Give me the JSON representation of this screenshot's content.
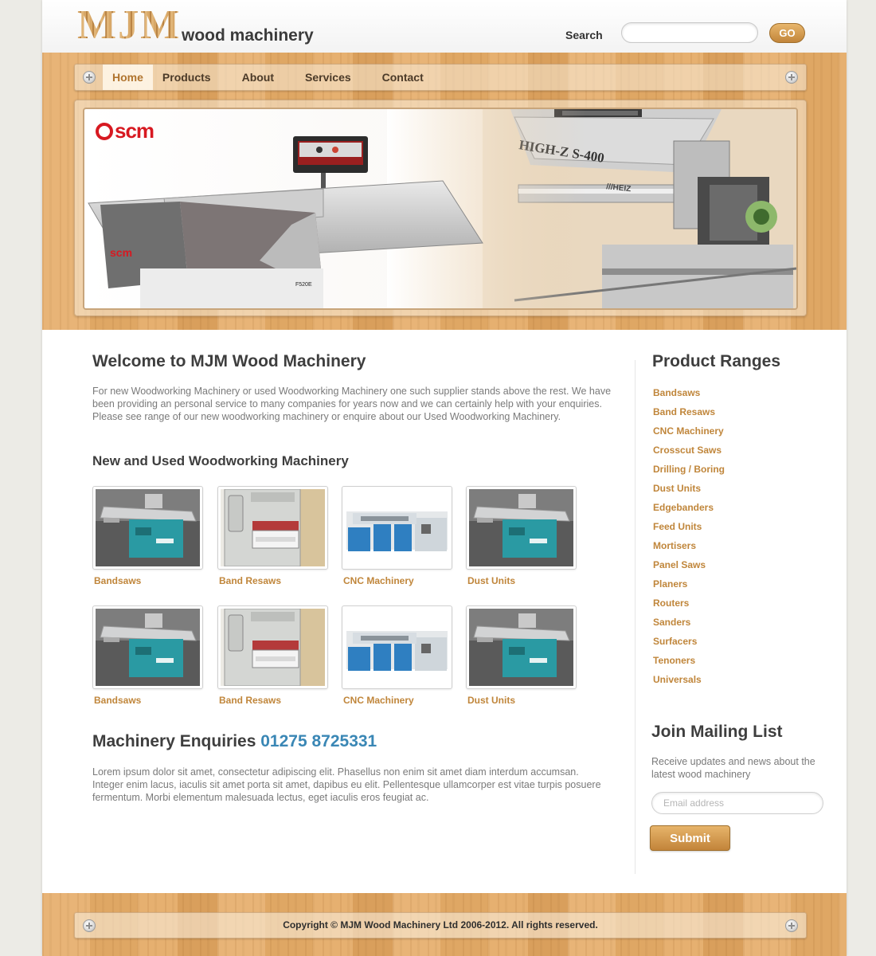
{
  "brand": {
    "logo_text": "MJM",
    "tagline": "wood machinery"
  },
  "search": {
    "label": "Search",
    "value": "",
    "placeholder": "",
    "button_label": "GO"
  },
  "nav": {
    "items": [
      {
        "label": "Home",
        "active": true
      },
      {
        "label": "Products",
        "active": false
      },
      {
        "label": "About",
        "active": false
      },
      {
        "label": "Services",
        "active": false
      },
      {
        "label": "Contact",
        "active": false
      }
    ]
  },
  "banner": {
    "brand_logo": "scm",
    "machine_left_badge": "scm",
    "machine_left_model": "F520E",
    "machine_right_label": "HIGH-Z S-400",
    "machine_right_maker": "///HEIZ"
  },
  "main": {
    "welcome_title": "Welcome to MJM Wood Machinery",
    "welcome_text": "For new Woodworking Machinery or used Woodworking Machinery one such supplier stands above the rest. We have been providing an personal service to many companies for years now and we can certainly help with your enquiries. Please see range of our new woodworking machinery or enquire about our Used Woodworking Machinery.",
    "section_title": "New and Used Woodworking Machinery",
    "products": [
      {
        "label": "Bandsaws",
        "image": "spindle-moulder"
      },
      {
        "label": "Band Resaws",
        "image": "wide-belt-sander"
      },
      {
        "label": "CNC Machinery",
        "image": "four-sided-planer"
      },
      {
        "label": "Dust Units",
        "image": "spindle-moulder"
      },
      {
        "label": "Bandsaws",
        "image": "spindle-moulder"
      },
      {
        "label": "Band Resaws",
        "image": "wide-belt-sander"
      },
      {
        "label": "CNC Machinery",
        "image": "four-sided-planer"
      },
      {
        "label": "Dust Units",
        "image": "spindle-moulder"
      }
    ],
    "enquiries_title": "Machinery Enquiries",
    "enquiries_phone": "01275 8725331",
    "enquiries_text": "Lorem ipsum dolor sit amet, consectetur adipiscing elit. Phasellus non enim sit amet diam interdum accumsan. Integer enim lacus, iaculis sit amet porta sit amet, dapibus eu elit. Pellentesque ullamcorper est vitae turpis posuere fermentum. Morbi elementum malesuada lectus, eget iaculis eros feugiat ac."
  },
  "sidebar": {
    "ranges_title": "Product Ranges",
    "ranges": [
      "Bandsaws",
      "Band Resaws",
      "CNC Machinery",
      "Crosscut Saws",
      "Drilling / Boring",
      "Dust Units",
      "Edgebanders",
      "Feed Units",
      "Mortisers",
      "Panel Saws",
      "Planers",
      "Routers",
      "Sanders",
      "Surfacers",
      "Tenoners",
      "Universals"
    ],
    "mailing_title": "Join Mailing List",
    "mailing_text": "Receive updates and news about the latest wood machinery",
    "email_placeholder": "Email address",
    "email_value": "",
    "submit_label": "Submit"
  },
  "footer": {
    "copyright": "Copyright © MJM Wood Machinery Ltd 2006-2012. All rights reserved."
  },
  "colors": {
    "accent": "#c0863b",
    "phone": "#3a87b5",
    "wood": "#e2ab69",
    "button": "#d49d52"
  }
}
